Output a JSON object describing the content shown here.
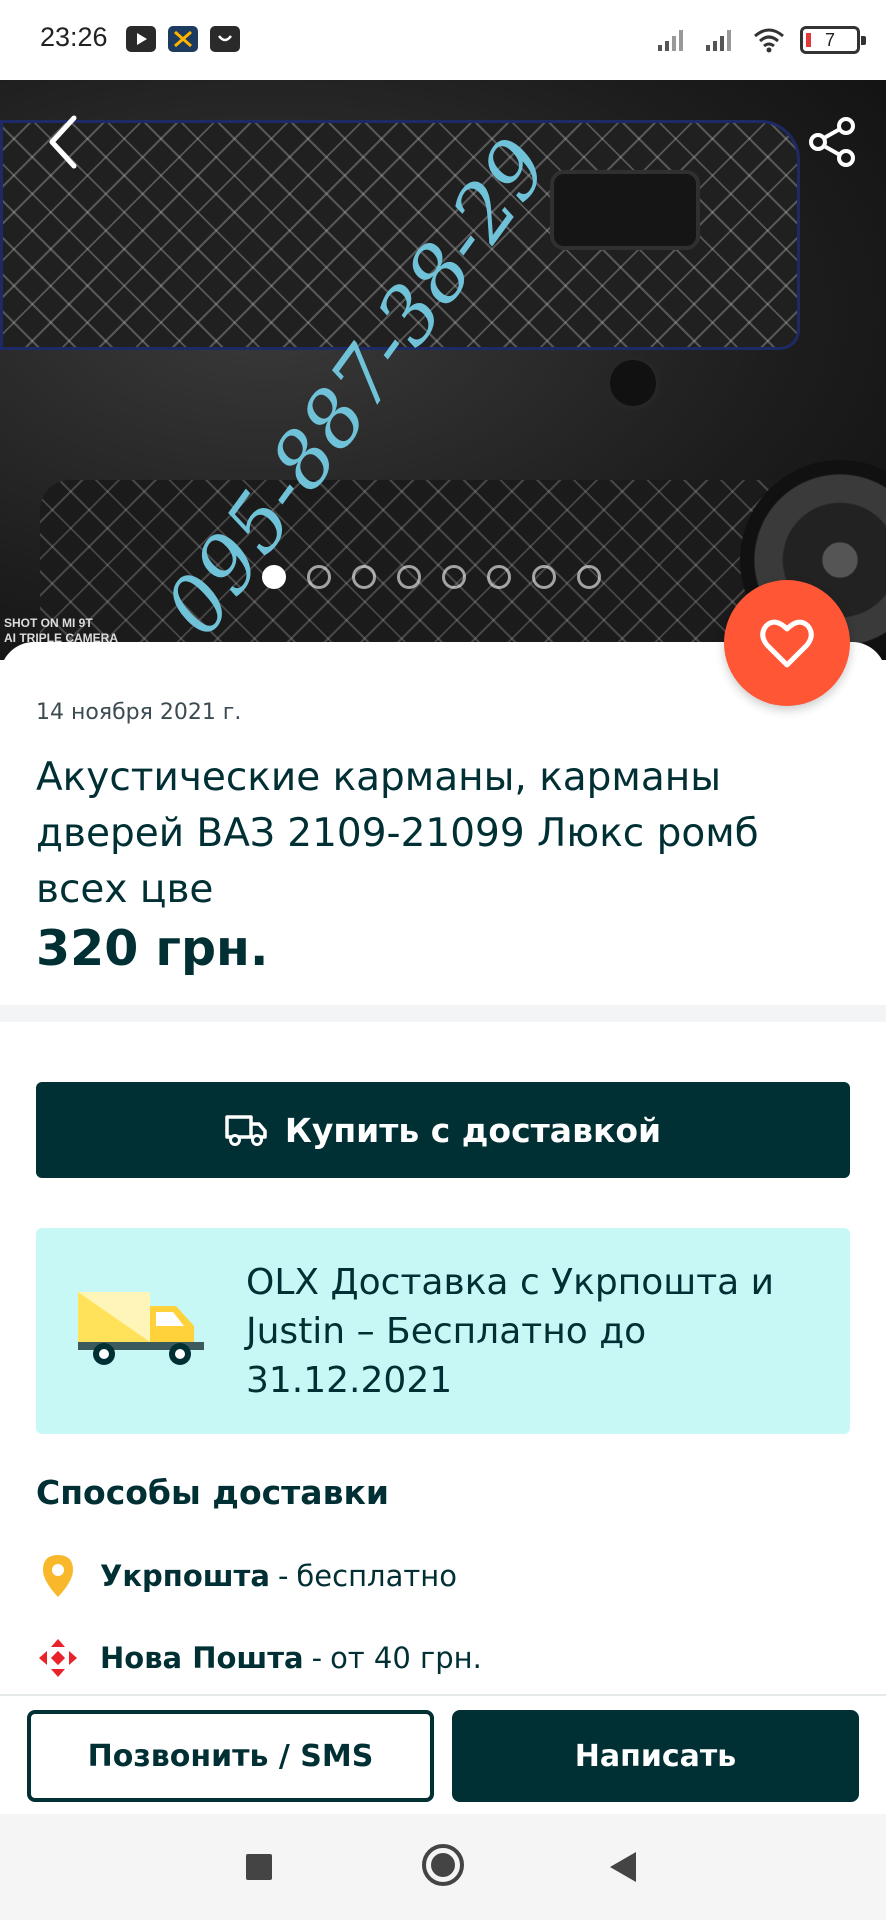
{
  "status_bar": {
    "time": "23:26",
    "battery_level": "7",
    "app_icons": [
      "youtube-icon",
      "app-icon",
      "shop-icon"
    ],
    "right_icons": [
      "signal-icon",
      "signal-icon",
      "wifi-icon",
      "battery-icon"
    ]
  },
  "gallery": {
    "watermark_text": "095-887-38-29",
    "camera_text_line1": "SHOT ON MI 9T",
    "camera_text_line2": "AI TRIPLE CAMERA",
    "page_count": 8,
    "active_page": 1
  },
  "listing": {
    "date": "14 ноября 2021 г.",
    "title": "Акустические карманы, карманы дверей ВАЗ 2109-21099 Люкс ромб всех цве",
    "price": "320 грн."
  },
  "buy_button": {
    "label": "Купить с доставкой"
  },
  "promo": {
    "text": "OLX Доставка с Укрпошта и Justin – Бесплатно до 31.12.2021"
  },
  "delivery": {
    "heading": "Способы доставки",
    "methods": [
      {
        "name": "Укрпошта",
        "separator": "-",
        "detail": "бесплатно",
        "icon": "location-pin-icon",
        "color": "#f9b82b"
      },
      {
        "name": "Нова Пошта",
        "separator": "-",
        "detail": "от 40 грн.",
        "icon": "nova-poshta-icon",
        "color": "#e8242a"
      }
    ]
  },
  "actions": {
    "call_label": "Позвонить / SMS",
    "write_label": "Написать"
  },
  "colors": {
    "primary": "#002f34",
    "accent": "#ff5636",
    "promo_bg": "#c8f8f6"
  }
}
